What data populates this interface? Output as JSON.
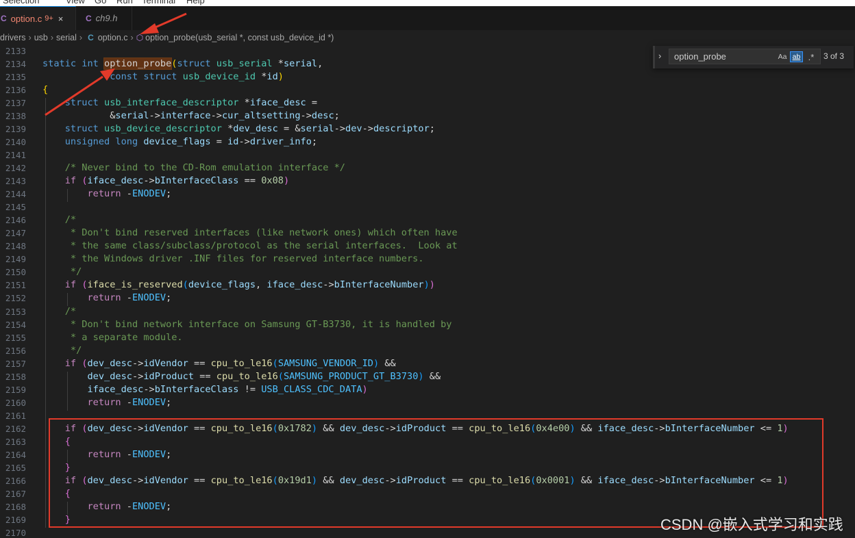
{
  "menu": [
    "Selection",
    "View",
    "Go",
    "Run",
    "Terminal",
    "Help"
  ],
  "tabs": [
    {
      "icon": "C",
      "label": "option.c",
      "badge": "9+",
      "close": "×"
    },
    {
      "icon": "C",
      "label": "ch9.h"
    }
  ],
  "breadcrumb": {
    "parts": [
      "drivers",
      "usb",
      "serial"
    ],
    "file_icon": "C",
    "file": "option.c",
    "symbol": "option_probe(usb_serial *, const usb_device_id *)"
  },
  "find": {
    "value": "option_probe",
    "match_case": "Aa",
    "whole_word": "ab",
    "regex": ".*",
    "count": "3 of 3"
  },
  "line_numbers": [
    "2133",
    "2134",
    "2135",
    "2136",
    "2137",
    "2138",
    "2139",
    "2140",
    "2141",
    "2142",
    "2143",
    "2144",
    "2145",
    "2146",
    "2147",
    "2148",
    "2149",
    "2150",
    "2151",
    "2152",
    "2153",
    "2154",
    "2155",
    "2156",
    "2157",
    "2158",
    "2159",
    "2160",
    "2161",
    "2162",
    "2163",
    "2164",
    "2165",
    "2166",
    "2167",
    "2168",
    "2169",
    "2170"
  ],
  "code": [
    [],
    [
      [
        "kw",
        "static "
      ],
      [
        "kw",
        "int "
      ],
      [
        "hl",
        "option_probe"
      ],
      [
        "br1",
        "("
      ],
      [
        "kw",
        "struct "
      ],
      [
        "ty",
        "usb_serial "
      ],
      [
        "pn",
        "*"
      ],
      [
        "var",
        "serial"
      ],
      [
        "pn",
        ","
      ]
    ],
    [
      [
        "pn",
        "            "
      ],
      [
        "kw",
        "const "
      ],
      [
        "kw",
        "struct "
      ],
      [
        "ty",
        "usb_device_id "
      ],
      [
        "pn",
        "*"
      ],
      [
        "var",
        "id"
      ],
      [
        "br1",
        ")"
      ]
    ],
    [
      [
        "br1",
        "{"
      ]
    ],
    [
      [
        "pn",
        "    "
      ],
      [
        "kw",
        "struct "
      ],
      [
        "ty",
        "usb_interface_descriptor "
      ],
      [
        "pn",
        "*"
      ],
      [
        "var",
        "iface_desc"
      ],
      [
        "pn",
        " ="
      ]
    ],
    [
      [
        "pn",
        "            "
      ],
      [
        "pn",
        "&"
      ],
      [
        "var",
        "serial"
      ],
      [
        "pn",
        "->"
      ],
      [
        "var",
        "interface"
      ],
      [
        "pn",
        "->"
      ],
      [
        "var",
        "cur_altsetting"
      ],
      [
        "pn",
        "->"
      ],
      [
        "var",
        "desc"
      ],
      [
        "pn",
        ";"
      ]
    ],
    [
      [
        "pn",
        "    "
      ],
      [
        "kw",
        "struct "
      ],
      [
        "ty",
        "usb_device_descriptor "
      ],
      [
        "pn",
        "*"
      ],
      [
        "var",
        "dev_desc"
      ],
      [
        "pn",
        " = &"
      ],
      [
        "var",
        "serial"
      ],
      [
        "pn",
        "->"
      ],
      [
        "var",
        "dev"
      ],
      [
        "pn",
        "->"
      ],
      [
        "var",
        "descriptor"
      ],
      [
        "pn",
        ";"
      ]
    ],
    [
      [
        "pn",
        "    "
      ],
      [
        "kw",
        "unsigned "
      ],
      [
        "kw",
        "long "
      ],
      [
        "var",
        "device_flags"
      ],
      [
        "pn",
        " = "
      ],
      [
        "var",
        "id"
      ],
      [
        "pn",
        "->"
      ],
      [
        "var",
        "driver_info"
      ],
      [
        "pn",
        ";"
      ]
    ],
    [],
    [
      [
        "pn",
        "    "
      ],
      [
        "cm",
        "/* Never bind to the CD-Rom emulation interface */"
      ]
    ],
    [
      [
        "pn",
        "    "
      ],
      [
        "ctl",
        "if "
      ],
      [
        "br2",
        "("
      ],
      [
        "var",
        "iface_desc"
      ],
      [
        "pn",
        "->"
      ],
      [
        "var",
        "bInterfaceClass"
      ],
      [
        "pn",
        " == "
      ],
      [
        "num",
        "0x08"
      ],
      [
        "br2",
        ")"
      ]
    ],
    [
      [
        "pn",
        "        "
      ],
      [
        "ctl",
        "return "
      ],
      [
        "pn",
        "-"
      ],
      [
        "mac",
        "ENODEV"
      ],
      [
        "pn",
        ";"
      ]
    ],
    [],
    [
      [
        "pn",
        "    "
      ],
      [
        "cm",
        "/*"
      ]
    ],
    [
      [
        "pn",
        "    "
      ],
      [
        "cm",
        " * Don't bind reserved interfaces (like network ones) which often have"
      ]
    ],
    [
      [
        "pn",
        "    "
      ],
      [
        "cm",
        " * the same class/subclass/protocol as the serial interfaces.  Look at"
      ]
    ],
    [
      [
        "pn",
        "    "
      ],
      [
        "cm",
        " * the Windows driver .INF files for reserved interface numbers."
      ]
    ],
    [
      [
        "pn",
        "    "
      ],
      [
        "cm",
        " */"
      ]
    ],
    [
      [
        "pn",
        "    "
      ],
      [
        "ctl",
        "if "
      ],
      [
        "br2",
        "("
      ],
      [
        "fn",
        "iface_is_reserved"
      ],
      [
        "br3",
        "("
      ],
      [
        "var",
        "device_flags"
      ],
      [
        "pn",
        ", "
      ],
      [
        "var",
        "iface_desc"
      ],
      [
        "pn",
        "->"
      ],
      [
        "var",
        "bInterfaceNumber"
      ],
      [
        "br3",
        ")"
      ],
      [
        "br2",
        ")"
      ]
    ],
    [
      [
        "pn",
        "        "
      ],
      [
        "ctl",
        "return "
      ],
      [
        "pn",
        "-"
      ],
      [
        "mac",
        "ENODEV"
      ],
      [
        "pn",
        ";"
      ]
    ],
    [
      [
        "pn",
        "    "
      ],
      [
        "cm",
        "/*"
      ]
    ],
    [
      [
        "pn",
        "    "
      ],
      [
        "cm",
        " * Don't bind network interface on Samsung GT-B3730, it is handled by"
      ]
    ],
    [
      [
        "pn",
        "    "
      ],
      [
        "cm",
        " * a separate module."
      ]
    ],
    [
      [
        "pn",
        "    "
      ],
      [
        "cm",
        " */"
      ]
    ],
    [
      [
        "pn",
        "    "
      ],
      [
        "ctl",
        "if "
      ],
      [
        "br2",
        "("
      ],
      [
        "var",
        "dev_desc"
      ],
      [
        "pn",
        "->"
      ],
      [
        "var",
        "idVendor"
      ],
      [
        "pn",
        " == "
      ],
      [
        "fn",
        "cpu_to_le16"
      ],
      [
        "br3",
        "("
      ],
      [
        "mac",
        "SAMSUNG_VENDOR_ID"
      ],
      [
        "br3",
        ")"
      ],
      [
        "pn",
        " &&"
      ]
    ],
    [
      [
        "pn",
        "        "
      ],
      [
        "var",
        "dev_desc"
      ],
      [
        "pn",
        "->"
      ],
      [
        "var",
        "idProduct"
      ],
      [
        "pn",
        " == "
      ],
      [
        "fn",
        "cpu_to_le16"
      ],
      [
        "br3",
        "("
      ],
      [
        "mac",
        "SAMSUNG_PRODUCT_GT_B3730"
      ],
      [
        "br3",
        ")"
      ],
      [
        "pn",
        " &&"
      ]
    ],
    [
      [
        "pn",
        "        "
      ],
      [
        "var",
        "iface_desc"
      ],
      [
        "pn",
        "->"
      ],
      [
        "var",
        "bInterfaceClass"
      ],
      [
        "pn",
        " != "
      ],
      [
        "mac",
        "USB_CLASS_CDC_DATA"
      ],
      [
        "br2",
        ")"
      ]
    ],
    [
      [
        "pn",
        "        "
      ],
      [
        "ctl",
        "return "
      ],
      [
        "pn",
        "-"
      ],
      [
        "mac",
        "ENODEV"
      ],
      [
        "pn",
        ";"
      ]
    ],
    [],
    [
      [
        "pn",
        "    "
      ],
      [
        "ctl",
        "if "
      ],
      [
        "br2",
        "("
      ],
      [
        "var",
        "dev_desc"
      ],
      [
        "pn",
        "->"
      ],
      [
        "var",
        "idVendor"
      ],
      [
        "pn",
        " == "
      ],
      [
        "fn",
        "cpu_to_le16"
      ],
      [
        "br3",
        "("
      ],
      [
        "num",
        "0x1782"
      ],
      [
        "br3",
        ")"
      ],
      [
        "pn",
        " && "
      ],
      [
        "var",
        "dev_desc"
      ],
      [
        "pn",
        "->"
      ],
      [
        "var",
        "idProduct"
      ],
      [
        "pn",
        " == "
      ],
      [
        "fn",
        "cpu_to_le16"
      ],
      [
        "br3",
        "("
      ],
      [
        "num",
        "0x4e00"
      ],
      [
        "br3",
        ")"
      ],
      [
        "pn",
        " && "
      ],
      [
        "var",
        "iface_desc"
      ],
      [
        "pn",
        "->"
      ],
      [
        "var",
        "bInterfaceNumber"
      ],
      [
        "pn",
        " <= "
      ],
      [
        "num",
        "1"
      ],
      [
        "br2",
        ")"
      ]
    ],
    [
      [
        "pn",
        "    "
      ],
      [
        "br2",
        "{"
      ]
    ],
    [
      [
        "pn",
        "        "
      ],
      [
        "ctl",
        "return "
      ],
      [
        "pn",
        "-"
      ],
      [
        "mac",
        "ENODEV"
      ],
      [
        "pn",
        ";"
      ]
    ],
    [
      [
        "pn",
        "    "
      ],
      [
        "br2",
        "}"
      ]
    ],
    [
      [
        "pn",
        "    "
      ],
      [
        "ctl",
        "if "
      ],
      [
        "br2",
        "("
      ],
      [
        "var",
        "dev_desc"
      ],
      [
        "pn",
        "->"
      ],
      [
        "var",
        "idVendor"
      ],
      [
        "pn",
        " == "
      ],
      [
        "fn",
        "cpu_to_le16"
      ],
      [
        "br3",
        "("
      ],
      [
        "num",
        "0x19d1"
      ],
      [
        "br3",
        ")"
      ],
      [
        "pn",
        " && "
      ],
      [
        "var",
        "dev_desc"
      ],
      [
        "pn",
        "->"
      ],
      [
        "var",
        "idProduct"
      ],
      [
        "pn",
        " == "
      ],
      [
        "fn",
        "cpu_to_le16"
      ],
      [
        "br3",
        "("
      ],
      [
        "num",
        "0x0001"
      ],
      [
        "br3",
        ")"
      ],
      [
        "pn",
        " && "
      ],
      [
        "var",
        "iface_desc"
      ],
      [
        "pn",
        "->"
      ],
      [
        "var",
        "bInterfaceNumber"
      ],
      [
        "pn",
        " <= "
      ],
      [
        "num",
        "1"
      ],
      [
        "br2",
        ")"
      ]
    ],
    [
      [
        "pn",
        "    "
      ],
      [
        "br2",
        "{"
      ]
    ],
    [
      [
        "pn",
        "        "
      ],
      [
        "ctl",
        "return "
      ],
      [
        "pn",
        "-"
      ],
      [
        "mac",
        "ENODEV"
      ],
      [
        "pn",
        ";"
      ]
    ],
    [
      [
        "pn",
        "    "
      ],
      [
        "br2",
        "}"
      ]
    ],
    []
  ],
  "watermark": "CSDN @嵌入式学习和实践",
  "colors": {
    "annotation_red": "#e23a2a",
    "accent_blue": "#0078d4",
    "find_highlight": "#613214"
  }
}
